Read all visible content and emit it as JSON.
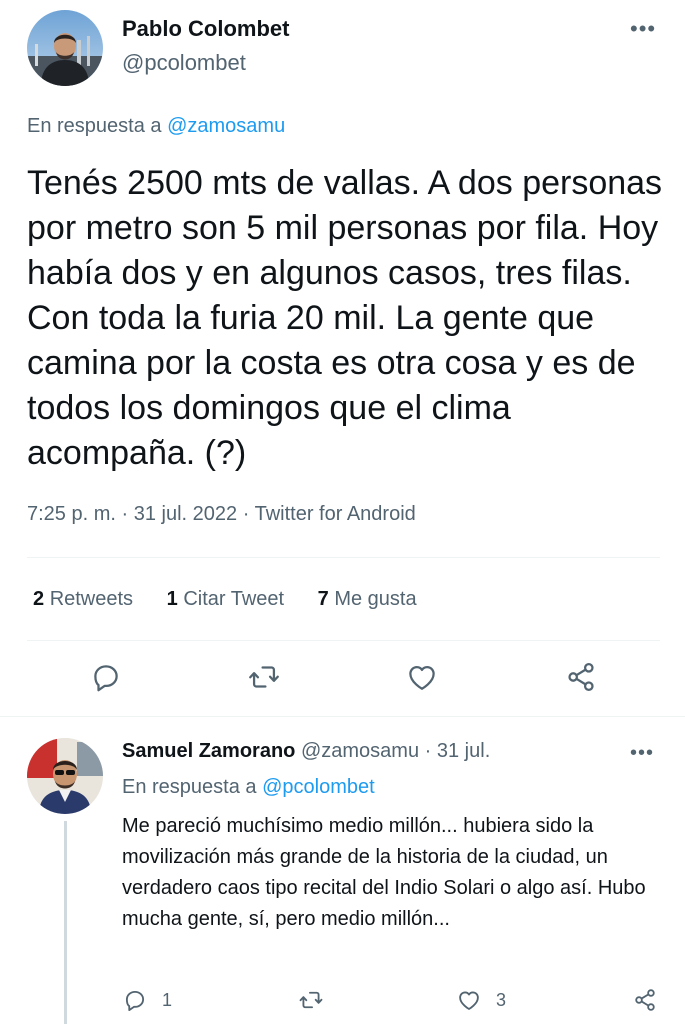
{
  "main_tweet": {
    "author_name": "Pablo Colombet",
    "author_handle": "@pcolombet",
    "reply_prefix": "En respuesta a",
    "reply_to": "@zamosamu",
    "text": "Tenés 2500 mts de vallas. A dos personas por metro son 5 mil personas por fila. Hoy había dos y en algunos casos, tres filas. Con toda la furia 20 mil. La gente que camina por la costa es otra cosa y es de todos los domingos que el clima acompaña. (?)",
    "time": "7:25 p. m.",
    "separator": "·",
    "date": "31 jul. 2022",
    "source": "Twitter for Android",
    "more_icon": "more-horizontal-icon",
    "stats": {
      "retweets_count": "2",
      "retweets_label": "Retweets",
      "quotes_count": "1",
      "quotes_label": "Citar Tweet",
      "likes_count": "7",
      "likes_label": "Me gusta"
    },
    "actions": [
      "reply-icon",
      "retweet-icon",
      "like-icon",
      "share-icon"
    ]
  },
  "reply_tweet": {
    "author_name": "Samuel Zamorano",
    "author_handle": "@zamosamu",
    "separator": "·",
    "date": "31 jul.",
    "reply_prefix": "En respuesta a",
    "reply_to": "@pcolombet",
    "text": "Me pareció muchísimo medio millón... hubiera sido la movilización más grande de la historia de la ciudad, un verdadero caos tipo recital del Indio Solari o algo así. Hubo mucha gente, sí, pero medio millón...",
    "reply_count": "1",
    "retweet_count": "",
    "like_count": "3"
  },
  "colors": {
    "text_primary": "#0f1419",
    "text_secondary": "#536471",
    "link": "#1d9bf0",
    "divider": "#eff3f4",
    "thread_line": "#cfd9de"
  }
}
